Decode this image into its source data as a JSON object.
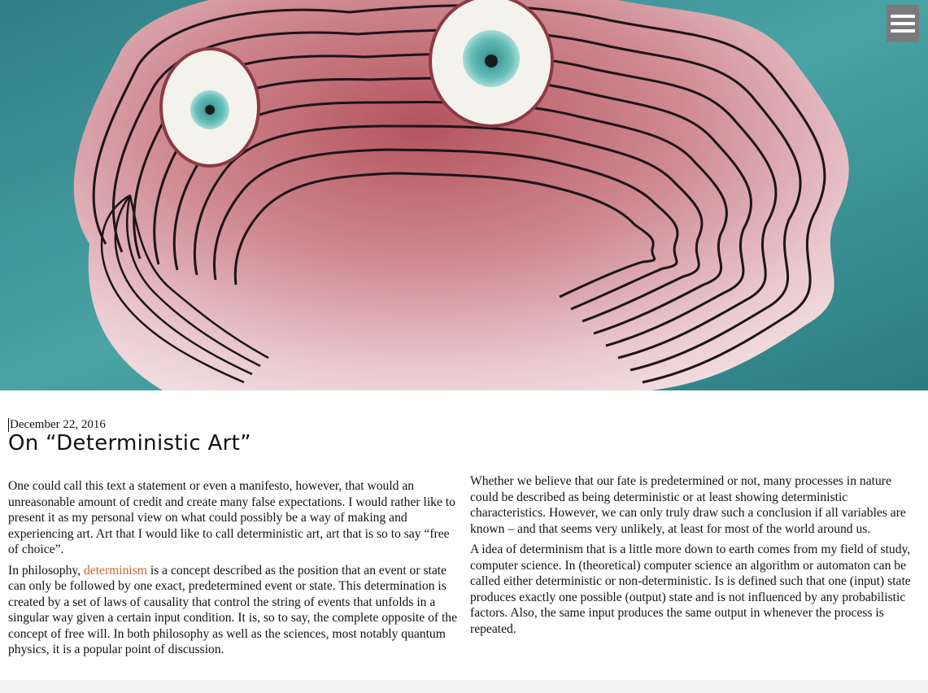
{
  "header": {
    "hero_image": "painting-of-wavy-striped-creature-with-two-eyes",
    "menu_icon": "hamburger-menu-icon",
    "colors": {
      "teal": "#3a8c8f",
      "pink": "#c97d84",
      "menu": "#7a7a7a",
      "link": "#c8642e"
    }
  },
  "post": {
    "date": "December 22, 2016",
    "title": "On “Deterministic Art”",
    "left": {
      "p1": "One could call this text a statement or even a manifesto, however, that would an unreasonable amount of credit and create many false expectations. I would rather like to present it as my personal view on what could possibly be a way of making and experiencing art. Art that I would like to call deterministic art, art that is so to say “free of choice”.",
      "p2_before": "In philosophy, ",
      "p2_link": "determinism",
      "p2_after": " is a concept described as the position that an event or state can only be followed by one exact, predetermined event or state. This determination is created by a set of laws of causality that control the string of events that unfolds in a singular way given a certain input condition. It is, so to say, the complete opposite of the concept of free will. In both philosophy as well as the sciences, most notably quantum physics, it is a popular point of discussion."
    },
    "right": {
      "p1": "Whether we believe that our fate is predetermined or not, many processes in nature could be described as being deterministic or at least showing deterministic characteristics. However, we can only truly draw such a conclusion if all variables are known – and that seems very unlikely, at least for most of the world around us.",
      "p2": "A idea of determinism that is a little more down to earth comes from my field of study, computer science. In (theoretical) computer science an algorithm or automaton can be called either deterministic or non-deterministic. Is is defined such that one (input) state produces exactly one possible (output) state and is not influenced by any probabilistic factors. Also, the same input produces the same output in whenever the process is repeated."
    }
  }
}
